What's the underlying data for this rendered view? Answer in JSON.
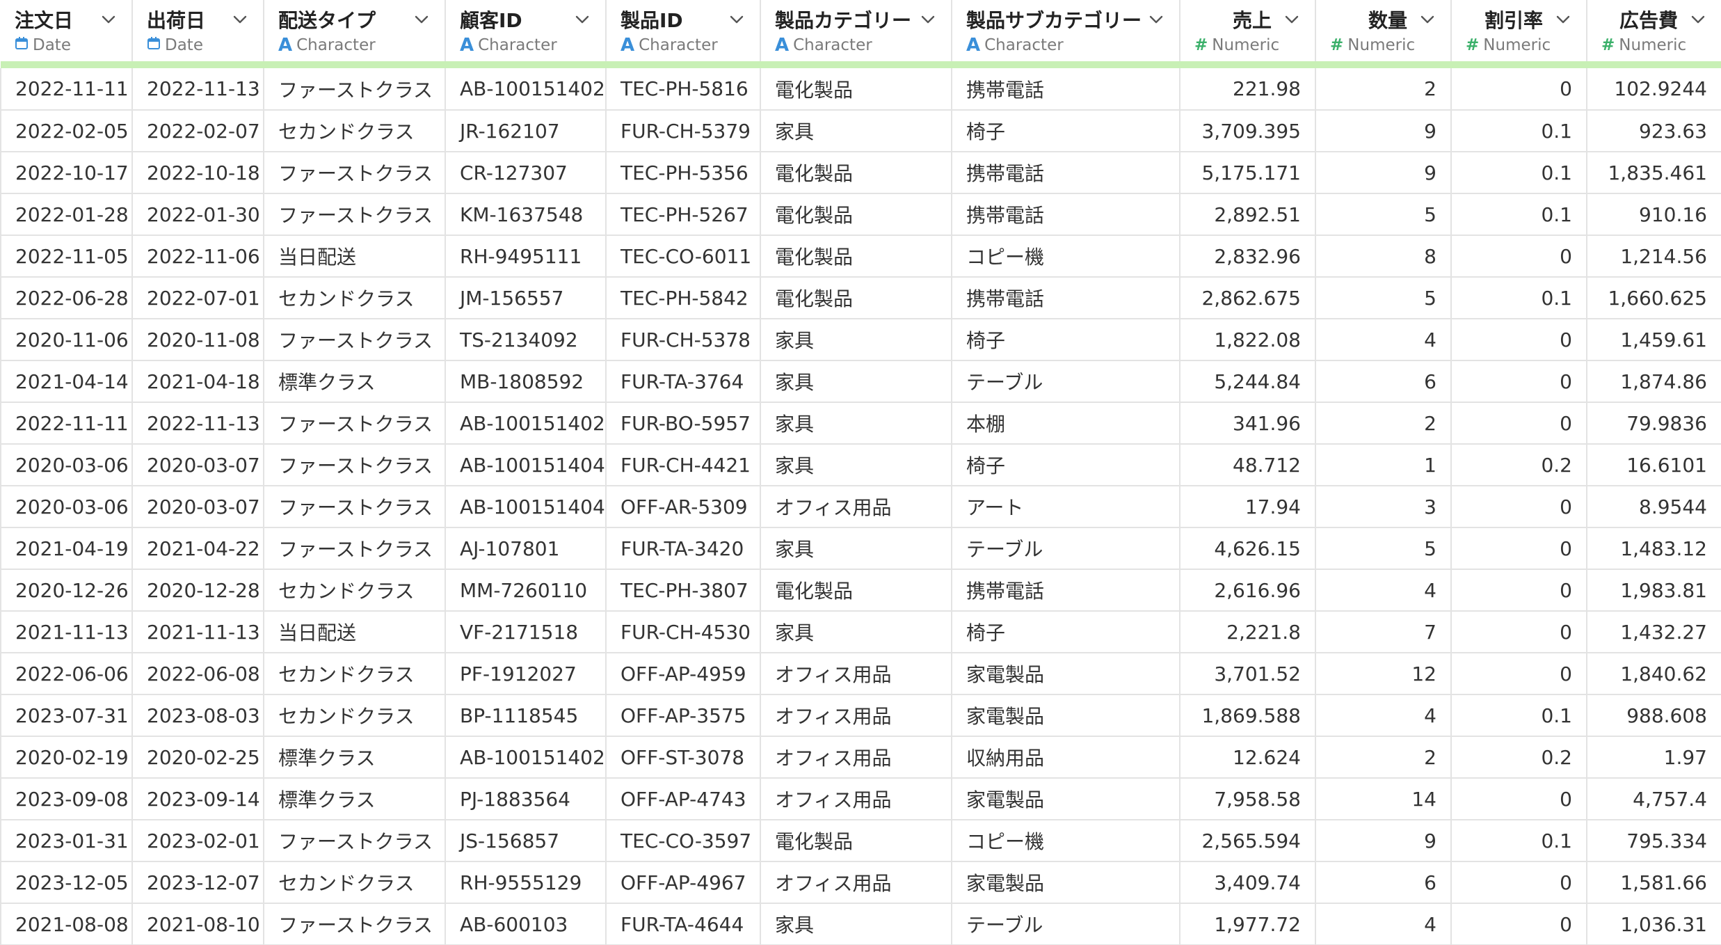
{
  "colors": {
    "date_icon": "#3a8fd9",
    "char_icon": "#3a8fd9",
    "num_icon": "#3bb06a",
    "header_bar": "#c8f0b5"
  },
  "columns": [
    {
      "name": "注文日",
      "type": "Date",
      "icon": "calendar-icon",
      "numeric": false
    },
    {
      "name": "出荷日",
      "type": "Date",
      "icon": "calendar-icon",
      "numeric": false
    },
    {
      "name": "配送タイプ",
      "type": "Character",
      "icon": "character-type-icon",
      "numeric": false
    },
    {
      "name": "顧客ID",
      "type": "Character",
      "icon": "character-type-icon",
      "numeric": false
    },
    {
      "name": "製品ID",
      "type": "Character",
      "icon": "character-type-icon",
      "numeric": false
    },
    {
      "name": "製品カテゴリー",
      "type": "Character",
      "icon": "character-type-icon",
      "numeric": false
    },
    {
      "name": "製品サブカテゴリー",
      "type": "Character",
      "icon": "character-type-icon",
      "numeric": false
    },
    {
      "name": "売上",
      "type": "Numeric",
      "icon": "numeric-type-icon",
      "numeric": true
    },
    {
      "name": "数量",
      "type": "Numeric",
      "icon": "numeric-type-icon",
      "numeric": true
    },
    {
      "name": "割引率",
      "type": "Numeric",
      "icon": "numeric-type-icon",
      "numeric": true
    },
    {
      "name": "広告費",
      "type": "Numeric",
      "icon": "numeric-type-icon",
      "numeric": true
    }
  ],
  "rows": [
    [
      "2022-11-11",
      "2022-11-13",
      "ファーストクラス",
      "AB-100151402",
      "TEC-PH-5816",
      "電化製品",
      "携帯電話",
      "221.98",
      "2",
      "0",
      "102.9244"
    ],
    [
      "2022-02-05",
      "2022-02-07",
      "セカンドクラス",
      "JR-162107",
      "FUR-CH-5379",
      "家具",
      "椅子",
      "3,709.395",
      "9",
      "0.1",
      "923.63"
    ],
    [
      "2022-10-17",
      "2022-10-18",
      "ファーストクラス",
      "CR-127307",
      "TEC-PH-5356",
      "電化製品",
      "携帯電話",
      "5,175.171",
      "9",
      "0.1",
      "1,835.461"
    ],
    [
      "2022-01-28",
      "2022-01-30",
      "ファーストクラス",
      "KM-1637548",
      "TEC-PH-5267",
      "電化製品",
      "携帯電話",
      "2,892.51",
      "5",
      "0.1",
      "910.16"
    ],
    [
      "2022-11-05",
      "2022-11-06",
      "当日配送",
      "RH-9495111",
      "TEC-CO-6011",
      "電化製品",
      "コピー機",
      "2,832.96",
      "8",
      "0",
      "1,214.56"
    ],
    [
      "2022-06-28",
      "2022-07-01",
      "セカンドクラス",
      "JM-156557",
      "TEC-PH-5842",
      "電化製品",
      "携帯電話",
      "2,862.675",
      "5",
      "0.1",
      "1,660.625"
    ],
    [
      "2020-11-06",
      "2020-11-08",
      "ファーストクラス",
      "TS-2134092",
      "FUR-CH-5378",
      "家具",
      "椅子",
      "1,822.08",
      "4",
      "0",
      "1,459.61"
    ],
    [
      "2021-04-14",
      "2021-04-18",
      "標準クラス",
      "MB-1808592",
      "FUR-TA-3764",
      "家具",
      "テーブル",
      "5,244.84",
      "6",
      "0",
      "1,874.86"
    ],
    [
      "2022-11-11",
      "2022-11-13",
      "ファーストクラス",
      "AB-100151402",
      "FUR-BO-5957",
      "家具",
      "本棚",
      "341.96",
      "2",
      "0",
      "79.9836"
    ],
    [
      "2020-03-06",
      "2020-03-07",
      "ファーストクラス",
      "AB-100151404",
      "FUR-CH-4421",
      "家具",
      "椅子",
      "48.712",
      "1",
      "0.2",
      "16.6101"
    ],
    [
      "2020-03-06",
      "2020-03-07",
      "ファーストクラス",
      "AB-100151404",
      "OFF-AR-5309",
      "オフィス用品",
      "アート",
      "17.94",
      "3",
      "0",
      "8.9544"
    ],
    [
      "2021-04-19",
      "2021-04-22",
      "ファーストクラス",
      "AJ-107801",
      "FUR-TA-3420",
      "家具",
      "テーブル",
      "4,626.15",
      "5",
      "0",
      "1,483.12"
    ],
    [
      "2020-12-26",
      "2020-12-28",
      "セカンドクラス",
      "MM-7260110",
      "TEC-PH-3807",
      "電化製品",
      "携帯電話",
      "2,616.96",
      "4",
      "0",
      "1,983.81"
    ],
    [
      "2021-11-13",
      "2021-11-13",
      "当日配送",
      "VF-2171518",
      "FUR-CH-4530",
      "家具",
      "椅子",
      "2,221.8",
      "7",
      "0",
      "1,432.27"
    ],
    [
      "2022-06-06",
      "2022-06-08",
      "セカンドクラス",
      "PF-1912027",
      "OFF-AP-4959",
      "オフィス用品",
      "家電製品",
      "3,701.52",
      "12",
      "0",
      "1,840.62"
    ],
    [
      "2023-07-31",
      "2023-08-03",
      "セカンドクラス",
      "BP-1118545",
      "OFF-AP-3575",
      "オフィス用品",
      "家電製品",
      "1,869.588",
      "4",
      "0.1",
      "988.608"
    ],
    [
      "2020-02-19",
      "2020-02-25",
      "標準クラス",
      "AB-100151402",
      "OFF-ST-3078",
      "オフィス用品",
      "収納用品",
      "12.624",
      "2",
      "0.2",
      "1.97"
    ],
    [
      "2023-09-08",
      "2023-09-14",
      "標準クラス",
      "PJ-1883564",
      "OFF-AP-4743",
      "オフィス用品",
      "家電製品",
      "7,958.58",
      "14",
      "0",
      "4,757.4"
    ],
    [
      "2023-01-31",
      "2023-02-01",
      "ファーストクラス",
      "JS-156857",
      "TEC-CO-3597",
      "電化製品",
      "コピー機",
      "2,565.594",
      "9",
      "0.1",
      "795.334"
    ],
    [
      "2023-12-05",
      "2023-12-07",
      "セカンドクラス",
      "RH-9555129",
      "OFF-AP-4967",
      "オフィス用品",
      "家電製品",
      "3,409.74",
      "6",
      "0",
      "1,581.66"
    ],
    [
      "2021-08-08",
      "2021-08-10",
      "ファーストクラス",
      "AB-600103",
      "FUR-TA-4644",
      "家具",
      "テーブル",
      "1,977.72",
      "4",
      "0",
      "1,036.31"
    ]
  ]
}
